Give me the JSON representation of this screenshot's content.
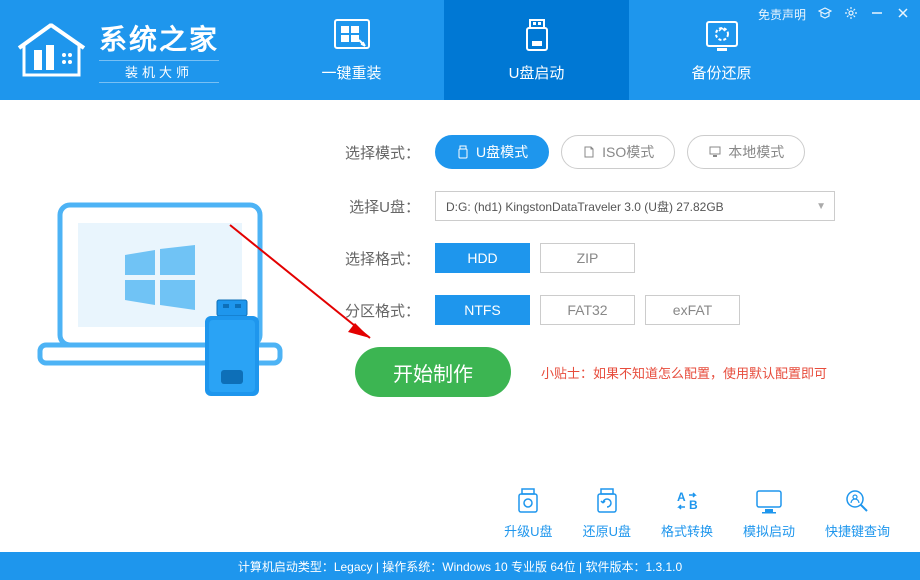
{
  "branding": {
    "title": "系统之家",
    "subtitle": "装机大师"
  },
  "window_controls": {
    "disclaimer": "免责声明"
  },
  "tabs": [
    {
      "label": "一键重装"
    },
    {
      "label": "U盘启动"
    },
    {
      "label": "备份还原"
    }
  ],
  "form": {
    "mode_label": "选择模式：",
    "modes": [
      {
        "label": "U盘模式"
      },
      {
        "label": "ISO模式"
      },
      {
        "label": "本地模式"
      }
    ],
    "usb_label": "选择U盘：",
    "usb_value": "D:G: (hd1) KingstonDataTraveler 3.0 (U盘) 27.82GB",
    "format_label": "选择格式：",
    "formats": [
      "HDD",
      "ZIP"
    ],
    "partition_label": "分区格式：",
    "partitions": [
      "NTFS",
      "FAT32",
      "exFAT"
    ],
    "start_button": "开始制作",
    "tip": "小贴士：如果不知道怎么配置，使用默认配置即可"
  },
  "tools": [
    {
      "label": "升级U盘"
    },
    {
      "label": "还原U盘"
    },
    {
      "label": "格式转换"
    },
    {
      "label": "模拟启动"
    },
    {
      "label": "快捷键查询"
    }
  ],
  "status_bar": "计算机启动类型：Legacy | 操作系统：Windows 10 专业版 64位 | 软件版本：1.3.1.0"
}
